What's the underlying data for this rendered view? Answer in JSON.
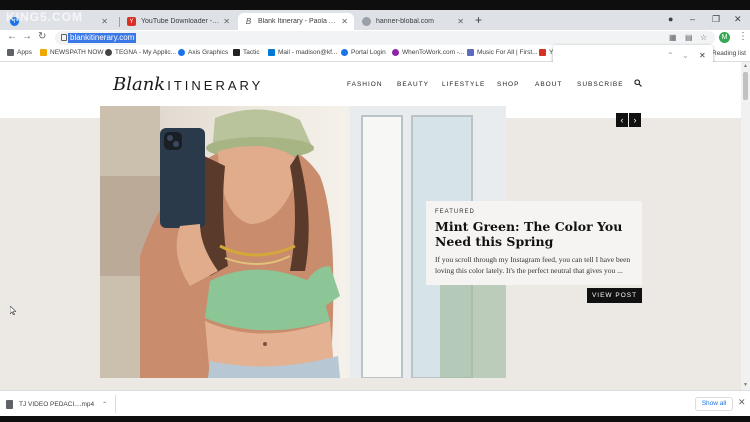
{
  "watermark": "KING5.COM",
  "tabs": [
    {
      "title": "",
      "color": "#1a73e8",
      "glyph": "f"
    },
    {
      "title": "YouTube Downloader - Download",
      "color": "#d93025",
      "glyph": "Y"
    },
    {
      "title": "Blank Itinerary - Paola Alberdi is",
      "color": "#555555",
      "glyph": "B"
    },
    {
      "title": "hanner-blobal.com",
      "color": "#9aa0a6",
      "glyph": ""
    }
  ],
  "toolbar": {
    "url": "blankitinerary.com",
    "avatar_letter": "M"
  },
  "bookmarks": [
    {
      "label": "Apps",
      "color": "#5f6368"
    },
    {
      "label": "NEWSPATH NOW",
      "color": "#f2a600"
    },
    {
      "label": "TEGNA - My Applic...",
      "color": "#444444"
    },
    {
      "label": "Axis Graphics",
      "color": "#1a73e8"
    },
    {
      "label": "Tactic",
      "color": "#222222"
    },
    {
      "label": "Mail - madison@kf...",
      "color": "#0078d4"
    },
    {
      "label": "Portal Login",
      "color": "#1a73e8"
    },
    {
      "label": "WhenToWork.com -...",
      "color": "#8e24aa"
    },
    {
      "label": "Music For All | First...",
      "color": "#5c6bc0"
    },
    {
      "label": "Y",
      "color": "#d93025"
    }
  ],
  "reading_list": "Reading list",
  "site": {
    "logo_script": "Blank",
    "logo_caps": "ITINERARY",
    "nav": [
      "FASHION",
      "BEAUTY",
      "LIFESTYLE",
      "SHOP",
      "ABOUT",
      "SUBSCRIBE"
    ]
  },
  "featured": {
    "kicker": "FEATURED",
    "headline": "Mint Green: The Color You Need this Spring",
    "excerpt": "If you scroll through my Instagram feed, you can tell I have been loving this color lately. It's the perfect neutral that gives you ...",
    "button": "VIEW POST"
  },
  "downloads": {
    "file": "TJ VIDEO PEDACI....mp4",
    "show_all": "Show all"
  }
}
